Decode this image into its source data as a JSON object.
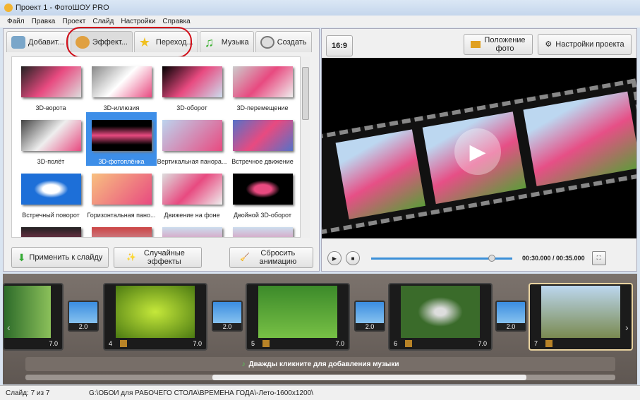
{
  "window": {
    "title": "Проект 1 - ФотоШОУ PRO"
  },
  "menu": [
    "Файл",
    "Правка",
    "Проект",
    "Слайд",
    "Настройки",
    "Справка"
  ],
  "tabs": [
    {
      "label": "Добавит...",
      "icon": "camera-icon"
    },
    {
      "label": "Эффект...",
      "icon": "palette-icon",
      "active": true
    },
    {
      "label": "Переход...",
      "icon": "star-icon"
    },
    {
      "label": "Музыка",
      "icon": "music-note-icon"
    },
    {
      "label": "Создать",
      "icon": "disc-icon"
    }
  ],
  "effects": [
    {
      "label": "3D-ворота"
    },
    {
      "label": "3D-иллюзия"
    },
    {
      "label": "3D-оборот"
    },
    {
      "label": "3D-перемещение"
    },
    {
      "label": "3D-полёт"
    },
    {
      "label": "3D-фотоплёнка",
      "selected": true
    },
    {
      "label": "Вертикальная панора..."
    },
    {
      "label": "Встречное движение"
    },
    {
      "label": "Встречный поворот"
    },
    {
      "label": "Горизонтальная пано..."
    },
    {
      "label": "Движение на фоне"
    },
    {
      "label": "Двойной 3D-оборот"
    },
    {
      "label": ""
    },
    {
      "label": ""
    },
    {
      "label": ""
    },
    {
      "label": ""
    }
  ],
  "buttons": {
    "apply": "Применить к слайду",
    "random": "Случайные эффекты",
    "reset": "Сбросить анимацию"
  },
  "toolbar": {
    "aspect": "16:9",
    "photo_position": "Положение фото",
    "project_settings": "Настройки проекта"
  },
  "player": {
    "time": "00:30.000 / 00:35.000",
    "progress": 0.857
  },
  "timeline": {
    "slides": [
      {
        "num": "",
        "dur": "7.0"
      },
      {
        "num": "4",
        "dur": "7.0"
      },
      {
        "num": "5",
        "dur": "7.0"
      },
      {
        "num": "6",
        "dur": "7.0"
      },
      {
        "num": "7",
        "dur": "",
        "current": true
      }
    ],
    "transitions": [
      "2.0",
      "2.0",
      "2.0",
      "2.0"
    ],
    "music_hint": "Дважды кликните для добавления музыки"
  },
  "status": {
    "slide": "Слайд: 7 из 7",
    "path": "G:\\ОБОИ для РАБОЧЕГО СТОЛА\\ВРЕМЕНА ГОДА\\-Лето-1600x1200\\"
  },
  "colors": {
    "accent": "#3d8ee8",
    "highlight_circle": "#d10b16"
  }
}
